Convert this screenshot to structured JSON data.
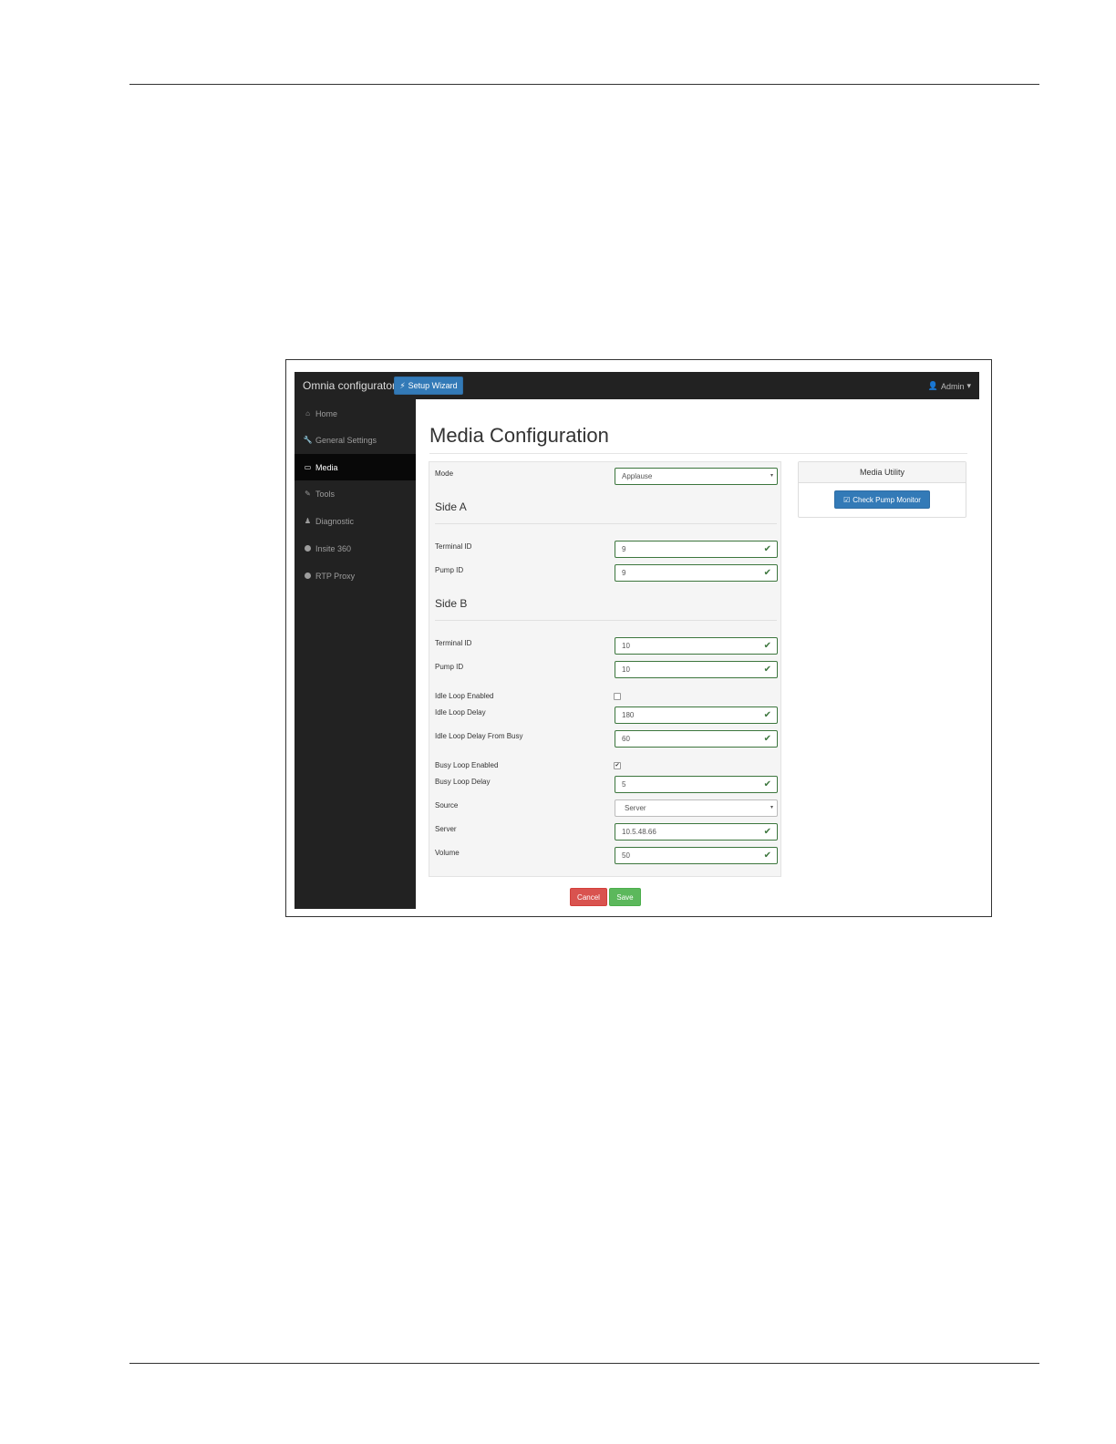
{
  "navbar": {
    "brand": "Omnia configurator",
    "wizard_icon": "bolt-icon",
    "wizard_label": "Setup Wizard",
    "user_icon": "user-icon",
    "user_label": "Admin",
    "user_caret": "▾"
  },
  "sidebar": {
    "items": [
      {
        "label": "Home",
        "icon": "home-icon",
        "glyph": "⌂"
      },
      {
        "label": "General Settings",
        "icon": "wrench-icon",
        "glyph": "🔧"
      },
      {
        "label": "Media",
        "icon": "monitor-icon",
        "glyph": "▭"
      },
      {
        "label": "Tools",
        "icon": "edit-icon",
        "glyph": "✎"
      },
      {
        "label": "Diagnostic",
        "icon": "user-md-icon",
        "glyph": "♟"
      },
      {
        "label": "Insite 360",
        "icon": "circle-icon",
        "glyph": ""
      },
      {
        "label": "RTP Proxy",
        "icon": "circle-icon",
        "glyph": ""
      }
    ],
    "active": "Media"
  },
  "page": {
    "title": "Media Configuration"
  },
  "form": {
    "mode_label": "Mode",
    "mode_value": "Applause",
    "side_a": {
      "heading": "Side A",
      "terminal_label": "Terminal ID",
      "terminal_value": "9",
      "pump_label": "Pump ID",
      "pump_value": "9"
    },
    "side_b": {
      "heading": "Side B",
      "terminal_label": "Terminal ID",
      "terminal_value": "10",
      "pump_label": "Pump ID",
      "pump_value": "10"
    },
    "idle_loop_enabled_label": "Idle Loop Enabled",
    "idle_loop_enabled": false,
    "idle_loop_delay_label": "Idle Loop Delay",
    "idle_loop_delay_value": "180",
    "idle_loop_delay_busy_label": "Idle Loop Delay From Busy",
    "idle_loop_delay_busy_value": "60",
    "busy_loop_enabled_label": "Busy Loop Enabled",
    "busy_loop_enabled": true,
    "busy_loop_delay_label": "Busy Loop Delay",
    "busy_loop_delay_value": "5",
    "source_label": "Source",
    "source_value": "Server",
    "server_label": "Server",
    "server_value": "10.5.48.66",
    "volume_label": "Volume",
    "volume_value": "50",
    "check_glyph": "✔",
    "checked_glyph": "✔",
    "select_caret": "▾"
  },
  "utility": {
    "heading": "Media Utility",
    "button_icon": "check-square-icon",
    "button_glyph": "☑",
    "button_label": "Check Pump Monitor"
  },
  "actions": {
    "cancel_label": "Cancel",
    "save_label": "Save"
  },
  "colors": {
    "navbar_bg": "#222222",
    "primary": "#337ab7",
    "success_border": "#3c763d",
    "danger": "#d9534f",
    "success": "#5cb85c"
  }
}
